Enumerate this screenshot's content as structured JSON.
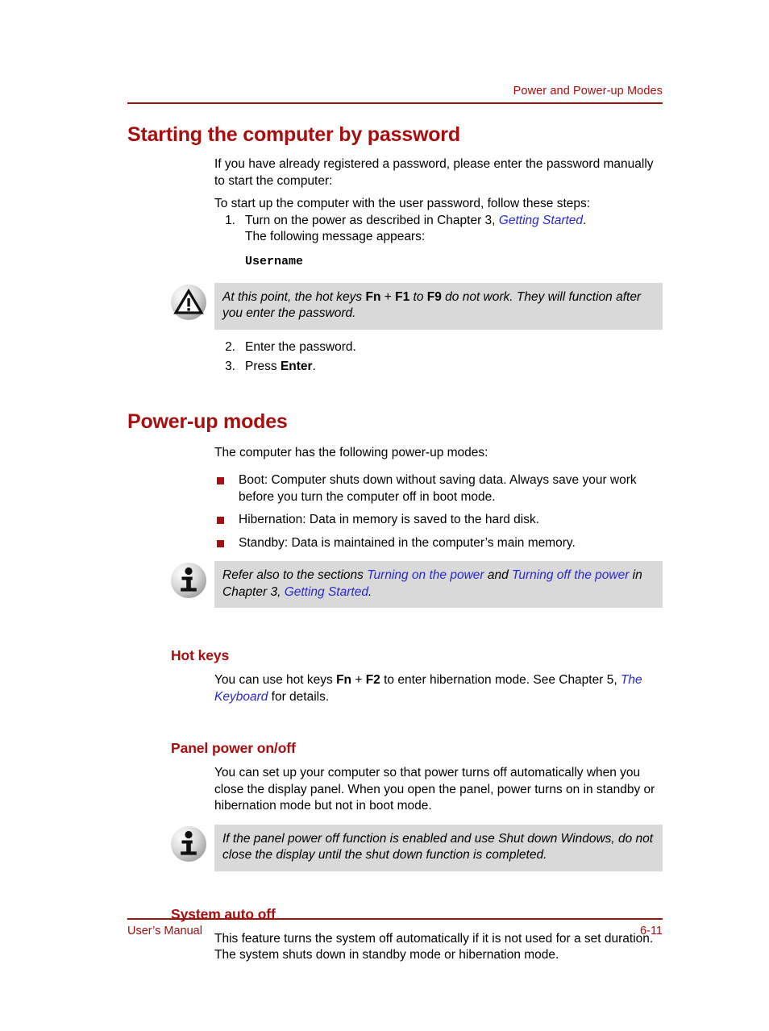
{
  "header": {
    "running_head": "Power and Power-up Modes",
    "rule_color": "#A50F0F"
  },
  "footer": {
    "left_text": "User’s Manual",
    "page_number": "6-11",
    "rule_color": "#A50F0F"
  },
  "colors": {
    "heading_red": "#A50F0F",
    "link_blue": "#2828CC",
    "callout_gray": "#D9D9D9",
    "bullet_red": "#A50F0F",
    "body_black": "#000000"
  },
  "sections": {
    "starting_by_password": {
      "title": "Starting the computer by password",
      "intro": "If you have already registered a password, please enter the password manually to start the computer:",
      "lead_in": "To start up the computer with the user password, follow these steps:",
      "steps": [
        {
          "num": "1.",
          "text_before_link": "Turn on the power as described in Chapter 3, ",
          "link": "Getting Started",
          "text_after_link": ".",
          "continuation": "The following message appears:"
        },
        {
          "num": "2.",
          "text": "Enter the password."
        },
        {
          "num": "3.",
          "text_before_bold": "Press ",
          "bold": "Enter",
          "text_after_bold": "."
        }
      ],
      "message_code": "Username",
      "warning_callout": {
        "icon": "warning-triangle-icon",
        "part1": "At this point, the hot keys ",
        "key1": "Fn",
        "part2": " + ",
        "key2": "F1",
        "part3": " to ",
        "key3": "F9",
        "part4": " do not work. They will function after you enter the password."
      }
    },
    "power_up_modes": {
      "title": "Power-up modes",
      "intro": "The computer has the following power-up modes:",
      "bullets": [
        "Boot: Computer shuts down without saving data. Always save your work before you turn the computer off in boot mode.",
        "Hibernation: Data in memory is saved to the hard disk.",
        "Standby: Data is maintained in the computer’s main memory."
      ],
      "info_callout": {
        "icon": "info-icon",
        "part1": "Refer also to the sections ",
        "link1": "Turning on the power",
        "part2": " and ",
        "link2": "Turning off the power",
        "part3": " in Chapter 3, ",
        "link3": "Getting Started",
        "part4": "."
      }
    },
    "hot_keys": {
      "title": "Hot keys",
      "part1": "You can use hot keys ",
      "key1": "Fn",
      "part2": " + ",
      "key2": "F2",
      "part3": " to enter hibernation mode. See Chapter 5, ",
      "link1": "The Keyboard",
      "part4": " for details."
    },
    "panel_power": {
      "title": "Panel power on/off",
      "body": "You can set up your computer so that power turns off automatically when you close the display panel. When you open the panel, power turns on in standby or hibernation mode but not in boot mode.",
      "info_callout": {
        "icon": "info-icon",
        "text": "If the panel power off function is enabled and use Shut down Windows, do not close the display until the shut down function is completed."
      }
    },
    "system_auto_off": {
      "title": "System auto off",
      "body": "This feature turns the system off automatically if it is not used for a set duration. The system shuts down in standby mode or hibernation mode."
    }
  }
}
